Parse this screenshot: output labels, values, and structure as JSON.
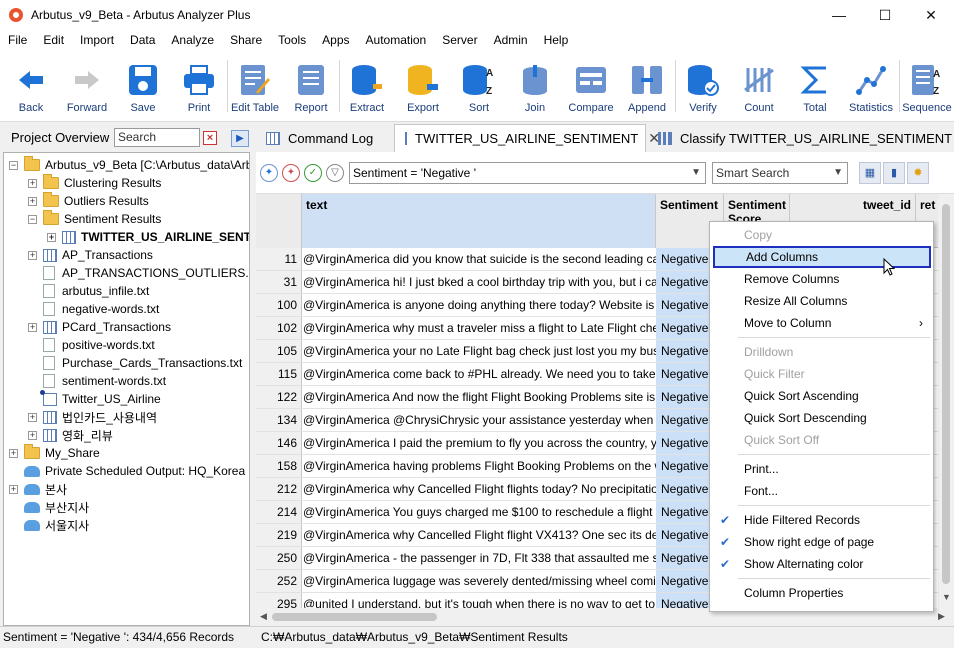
{
  "window": {
    "title": "Arbutus_v9_Beta - Arbutus Analyzer Plus",
    "minimize": "—",
    "maximize": "☐",
    "close": "✕"
  },
  "menu": [
    "File",
    "Edit",
    "Import",
    "Data",
    "Analyze",
    "Share",
    "Tools",
    "Apps",
    "Automation",
    "Server",
    "Admin",
    "Help"
  ],
  "toolbar": [
    {
      "label": "Back",
      "icon": "back-arrow-icon"
    },
    {
      "label": "Forward",
      "icon": "forward-arrow-icon"
    },
    {
      "label": "Save",
      "icon": "save-icon"
    },
    {
      "label": "Print",
      "icon": "print-icon"
    },
    {
      "label": "Edit Table",
      "icon": "edit-table-icon"
    },
    {
      "label": "Report",
      "icon": "report-icon"
    },
    {
      "label": "Extract",
      "icon": "extract-icon"
    },
    {
      "label": "Export",
      "icon": "export-icon"
    },
    {
      "label": "Sort",
      "icon": "sort-icon"
    },
    {
      "label": "Join",
      "icon": "join-icon"
    },
    {
      "label": "Compare",
      "icon": "compare-icon"
    },
    {
      "label": "Append",
      "icon": "append-icon"
    },
    {
      "label": "Verify",
      "icon": "verify-icon"
    },
    {
      "label": "Count",
      "icon": "count-icon"
    },
    {
      "label": "Total",
      "icon": "total-icon"
    },
    {
      "label": "Statistics",
      "icon": "statistics-icon"
    },
    {
      "label": "Sequence",
      "icon": "sequence-icon"
    }
  ],
  "project": {
    "title": "Project Overview",
    "search_placeholder": "Search",
    "tree": [
      {
        "label": "Arbutus_v9_Beta [C:\\Arbutus_data\\Arb",
        "type": "folder",
        "level": 0,
        "exp": "−"
      },
      {
        "label": "Clustering Results",
        "type": "folder",
        "level": 1,
        "exp": "+"
      },
      {
        "label": "Outliers Results",
        "type": "folder",
        "level": 1,
        "exp": "+"
      },
      {
        "label": "Sentiment Results",
        "type": "folder",
        "level": 1,
        "exp": "−"
      },
      {
        "label": "TWITTER_US_AIRLINE_SENTIM",
        "type": "table",
        "level": 2,
        "exp": "+",
        "bold": true
      },
      {
        "label": "AP_Transactions",
        "type": "table",
        "level": 1,
        "exp": "+"
      },
      {
        "label": "AP_TRANSACTIONS_OUTLIERS.txt",
        "type": "file",
        "level": 1,
        "exp": ""
      },
      {
        "label": "arbutus_infile.txt",
        "type": "file",
        "level": 1,
        "exp": ""
      },
      {
        "label": "negative-words.txt",
        "type": "file",
        "level": 1,
        "exp": ""
      },
      {
        "label": "PCard_Transactions",
        "type": "table",
        "level": 1,
        "exp": "+"
      },
      {
        "label": "positive-words.txt",
        "type": "file",
        "level": 1,
        "exp": ""
      },
      {
        "label": "Purchase_Cards_Transactions.txt",
        "type": "file",
        "level": 1,
        "exp": ""
      },
      {
        "label": "sentiment-words.txt",
        "type": "file",
        "level": 1,
        "exp": ""
      },
      {
        "label": "Twitter_US_Airline",
        "type": "linked",
        "level": 1,
        "exp": ""
      },
      {
        "label": "법인카드_사용내역",
        "type": "table",
        "level": 1,
        "exp": "+"
      },
      {
        "label": "영화_리뷰",
        "type": "table",
        "level": 1,
        "exp": "+"
      },
      {
        "label": "My_Share",
        "type": "folder",
        "level": 0,
        "exp": "+"
      },
      {
        "label": "Private Scheduled Output:  HQ_Korea",
        "type": "cloud",
        "level": 0,
        "exp": ""
      },
      {
        "label": "본사",
        "type": "cloud",
        "level": 0,
        "exp": "+"
      },
      {
        "label": "부산지사",
        "type": "cloud",
        "level": 0,
        "exp": ""
      },
      {
        "label": "서울지사",
        "type": "cloud",
        "level": 0,
        "exp": ""
      }
    ]
  },
  "tabs": [
    {
      "label": "Command Log",
      "active": false
    },
    {
      "label": "TWITTER_US_AIRLINE_SENTIMENT",
      "active": true
    },
    {
      "label": "Classify TWITTER_US_AIRLINE_SENTIMENT",
      "active": false
    }
  ],
  "filter": {
    "expression": "Sentiment = 'Negative '",
    "smart_search": "Smart Search"
  },
  "grid": {
    "headers": [
      "text",
      "Sentiment",
      "Sentiment Score",
      "tweet_id",
      "ret"
    ],
    "rows": [
      {
        "n": "11",
        "text": "@VirginAmerica did you know that suicide is the second leading ca",
        "sent": "Negative"
      },
      {
        "n": "31",
        "text": "@VirginAmerica hi! I just bked a cool birthday trip with you, but i ca",
        "sent": "Negative"
      },
      {
        "n": "100",
        "text": "@VirginAmerica is anyone doing anything there today?  Website is",
        "sent": "Negative"
      },
      {
        "n": "102",
        "text": "@VirginAmerica why must a traveler miss a flight to Late Flight che",
        "sent": "Negative"
      },
      {
        "n": "105",
        "text": "@VirginAmerica your no Late Flight bag check just lost you my bus",
        "sent": "Negative"
      },
      {
        "n": "115",
        "text": "@VirginAmerica come back to #PHL already. We need you to take u",
        "sent": "Negative"
      },
      {
        "n": "122",
        "text": "@VirginAmerica And now the flight Flight Booking Problems site is",
        "sent": "Negative"
      },
      {
        "n": "134",
        "text": "@VirginAmerica @ChrysiChrysic your assistance yesterday when u",
        "sent": "Negative"
      },
      {
        "n": "146",
        "text": "@VirginAmerica I paid the premium to fly you across the country, y",
        "sent": "Negative"
      },
      {
        "n": "158",
        "text": "@VirginAmerica having problems Flight Booking Problems on the w",
        "sent": "Negative"
      },
      {
        "n": "212",
        "text": "@VirginAmerica why Cancelled Flight flights today? No precipitatio",
        "sent": "Negative"
      },
      {
        "n": "214",
        "text": "@VirginAmerica You guys charged me $100 to reschedule a flight th",
        "sent": "Negative"
      },
      {
        "n": "219",
        "text": "@VirginAmerica why Cancelled Flight flight VX413? One sec its dela",
        "sent": "Negative"
      },
      {
        "n": "250",
        "text": "@VirginAmerica - the passenger in 7D, Flt 338 that assaulted me sho",
        "sent": "Negative"
      },
      {
        "n": "252",
        "text": "@VirginAmerica luggage was severely dented/missing wheel comin",
        "sent": "Negative"
      },
      {
        "n": "295",
        "text": "@united I understand, but it's tough when there is no way to get to",
        "sent": "Negative"
      }
    ]
  },
  "context_menu": [
    {
      "label": "Copy",
      "disabled": true
    },
    {
      "label": "Add Columns",
      "highlight": true
    },
    {
      "label": "Remove Columns"
    },
    {
      "label": "Resize All Columns"
    },
    {
      "label": "Move to Column",
      "submenu": "›"
    },
    {
      "sep": true
    },
    {
      "label": "Drilldown",
      "disabled": true
    },
    {
      "label": "Quick Filter",
      "disabled": true
    },
    {
      "label": "Quick Sort Ascending"
    },
    {
      "label": "Quick Sort Descending"
    },
    {
      "label": "Quick Sort Off",
      "disabled": true
    },
    {
      "sep": true
    },
    {
      "label": "Print..."
    },
    {
      "label": "Font..."
    },
    {
      "sep": true
    },
    {
      "label": "Hide Filtered Records",
      "checked": true
    },
    {
      "label": "Show right edge of page",
      "checked": true
    },
    {
      "label": "Show Alternating color",
      "checked": true
    },
    {
      "sep": true
    },
    {
      "label": "Column Properties"
    }
  ],
  "status": {
    "left": "Sentiment = 'Negative ': 434/4,656 Records",
    "right": "C:₩Arbutus_data₩Arbutus_v9_Beta₩Sentiment Results"
  }
}
